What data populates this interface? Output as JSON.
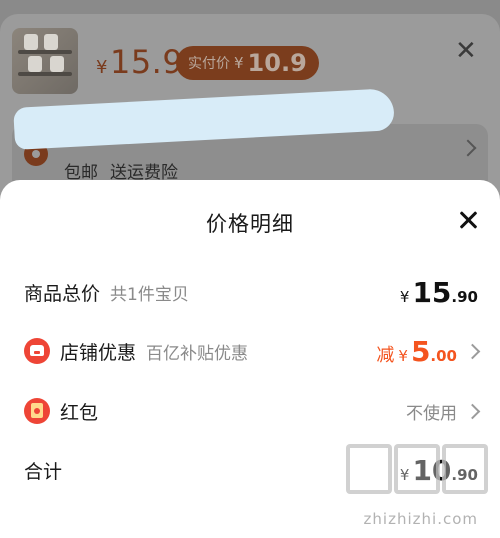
{
  "background": {
    "price_symbol": "¥",
    "price_value": "15.9",
    "real_price_label": "实付价",
    "real_price_symbol": "¥",
    "real_price_value": "10.9",
    "shipping_tags": [
      "包邮",
      "送运费险"
    ]
  },
  "sheet": {
    "title": "价格明细",
    "rows": [
      {
        "label": "商品总价",
        "sub": "共1件宝贝",
        "yen": "¥",
        "int": "15",
        "dec": ".90"
      },
      {
        "label": "店铺优惠",
        "sub": "百亿补贴优惠",
        "prefix": "减",
        "yen": "¥",
        "int": "5",
        "dec": ".00"
      },
      {
        "label": "红包",
        "value": "不使用"
      },
      {
        "label": "合计",
        "yen": "¥",
        "int": "10",
        "dec": ".90"
      }
    ]
  },
  "watermark": {
    "text": "zhizhizhi.com"
  },
  "colors": {
    "accent_red": "#f4541f",
    "icon_red": "#ee4536"
  }
}
